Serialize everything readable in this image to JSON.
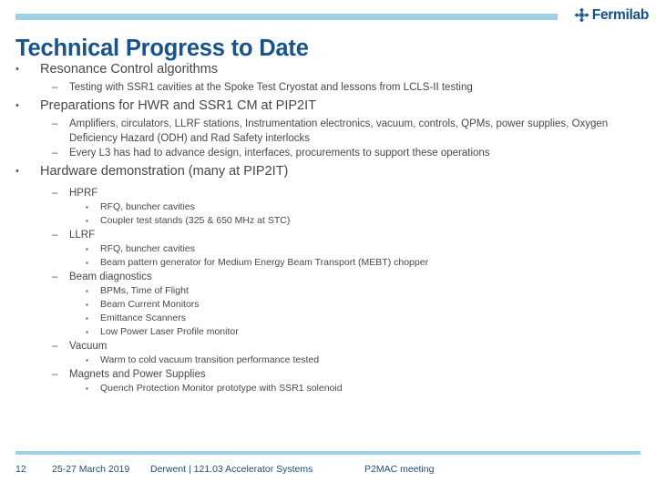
{
  "header": {
    "logo_mark": "fermilab-mark-icon",
    "logo_text": "Fermilab",
    "rule_color": "#9BD2E6"
  },
  "title": {
    "text": "Technical Progress to Date",
    "color": "#17538F"
  },
  "bullets": {
    "level1_glyph": "•",
    "level2_glyph": "–",
    "level3_glyph": "▪"
  },
  "outline": {
    "item1": "Resonance Control algorithms",
    "item1_sub1": "Testing with SSR1 cavities at the Spoke Test Cryostat and lessons from LCLS-II testing",
    "item2": "Preparations for HWR and SSR1 CM at PIP2IT",
    "item2_sub1": "Amplifiers, circulators, LLRF stations, Instrumentation electronics, vacuum, controls, QPMs, power supplies, Oxygen Deficiency Hazard (ODH) and Rad Safety interlocks",
    "item2_sub2": "Every L3 has had to advance design, interfaces, procurements to support these operations",
    "item3": "Hardware demonstration (many at PIP2IT)",
    "item3_sub1": "HPRF",
    "item3_sub1_a": "RFQ, buncher cavities",
    "item3_sub1_b": "Coupler test stands (325 & 650 MHz at STC)",
    "item3_sub2": "LLRF",
    "item3_sub2_a": "RFQ, buncher cavities",
    "item3_sub2_b": "Beam pattern generator for Medium Energy Beam Transport (MEBT) chopper",
    "item3_sub3": "Beam diagnostics",
    "item3_sub3_a": "BPMs, Time of Flight",
    "item3_sub3_b": "Beam Current Monitors",
    "item3_sub3_c": "Emittance Scanners",
    "item3_sub3_d": "Low Power Laser Profile monitor",
    "item3_sub4": "Vacuum",
    "item3_sub4_a": "Warm to cold vacuum transition performance tested",
    "item3_sub5": "Magnets and Power Supplies",
    "item3_sub5_a": "Quench Protection Monitor prototype with SSR1 solenoid"
  },
  "footer": {
    "slide_number": "12",
    "date": "25-27 March 2019",
    "owner": "Derwent | 121.03 Accelerator Systems",
    "meeting": "P2MAC meeting",
    "text_color": "#1F4E79",
    "rule_color": "#9BD2E6"
  }
}
